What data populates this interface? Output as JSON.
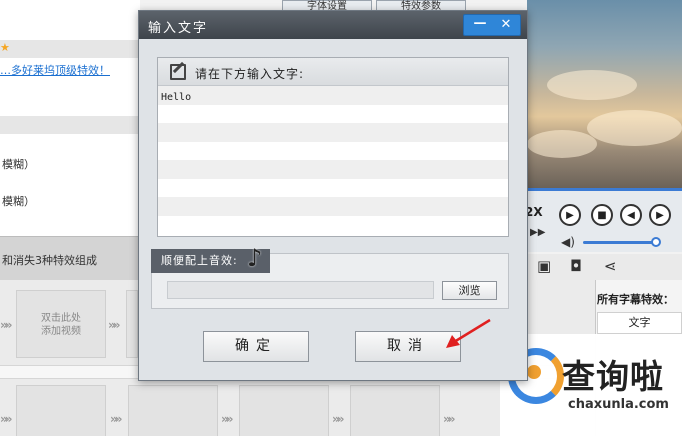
{
  "background": {
    "left_rows": [
      {
        "text": "…多好莱坞顶级特效！",
        "link": true
      },
      {
        "text": "模糊）",
        "link": false
      },
      {
        "text": "模糊）",
        "link": false
      }
    ],
    "tabs": [
      "字体设置",
      "特效参数"
    ],
    "strip_text": "和消失3种特效组成",
    "thumb_label": "双击此处\n添加视频",
    "player_speed": "2X",
    "right_panel": {
      "title": "所有字幕特效：",
      "column": "文字"
    },
    "logo": {
      "name": "查询啦",
      "url": "chaxunla.com"
    }
  },
  "dialog": {
    "title": "输入文字",
    "text_prompt": "请在下方输入文字:",
    "text_value": "Hello",
    "audio_label": "顺便配上音效:",
    "audio_path": "",
    "browse_label": "浏览",
    "ok_label": "确定",
    "cancel_label": "取消"
  },
  "colors": {
    "titlebar": "#4a5058",
    "window_buttons": "#2f86d8",
    "accent_blue": "#3b7bd4",
    "arrow_red": "#e02020",
    "logo_orange": "#f0a030"
  },
  "icons": [
    "edit-icon",
    "music-note-icon",
    "minimize-icon",
    "close-icon",
    "play-icon",
    "stop-icon",
    "prev-icon",
    "next-icon",
    "volume-icon",
    "save-icon",
    "help-icon",
    "share-icon"
  ]
}
